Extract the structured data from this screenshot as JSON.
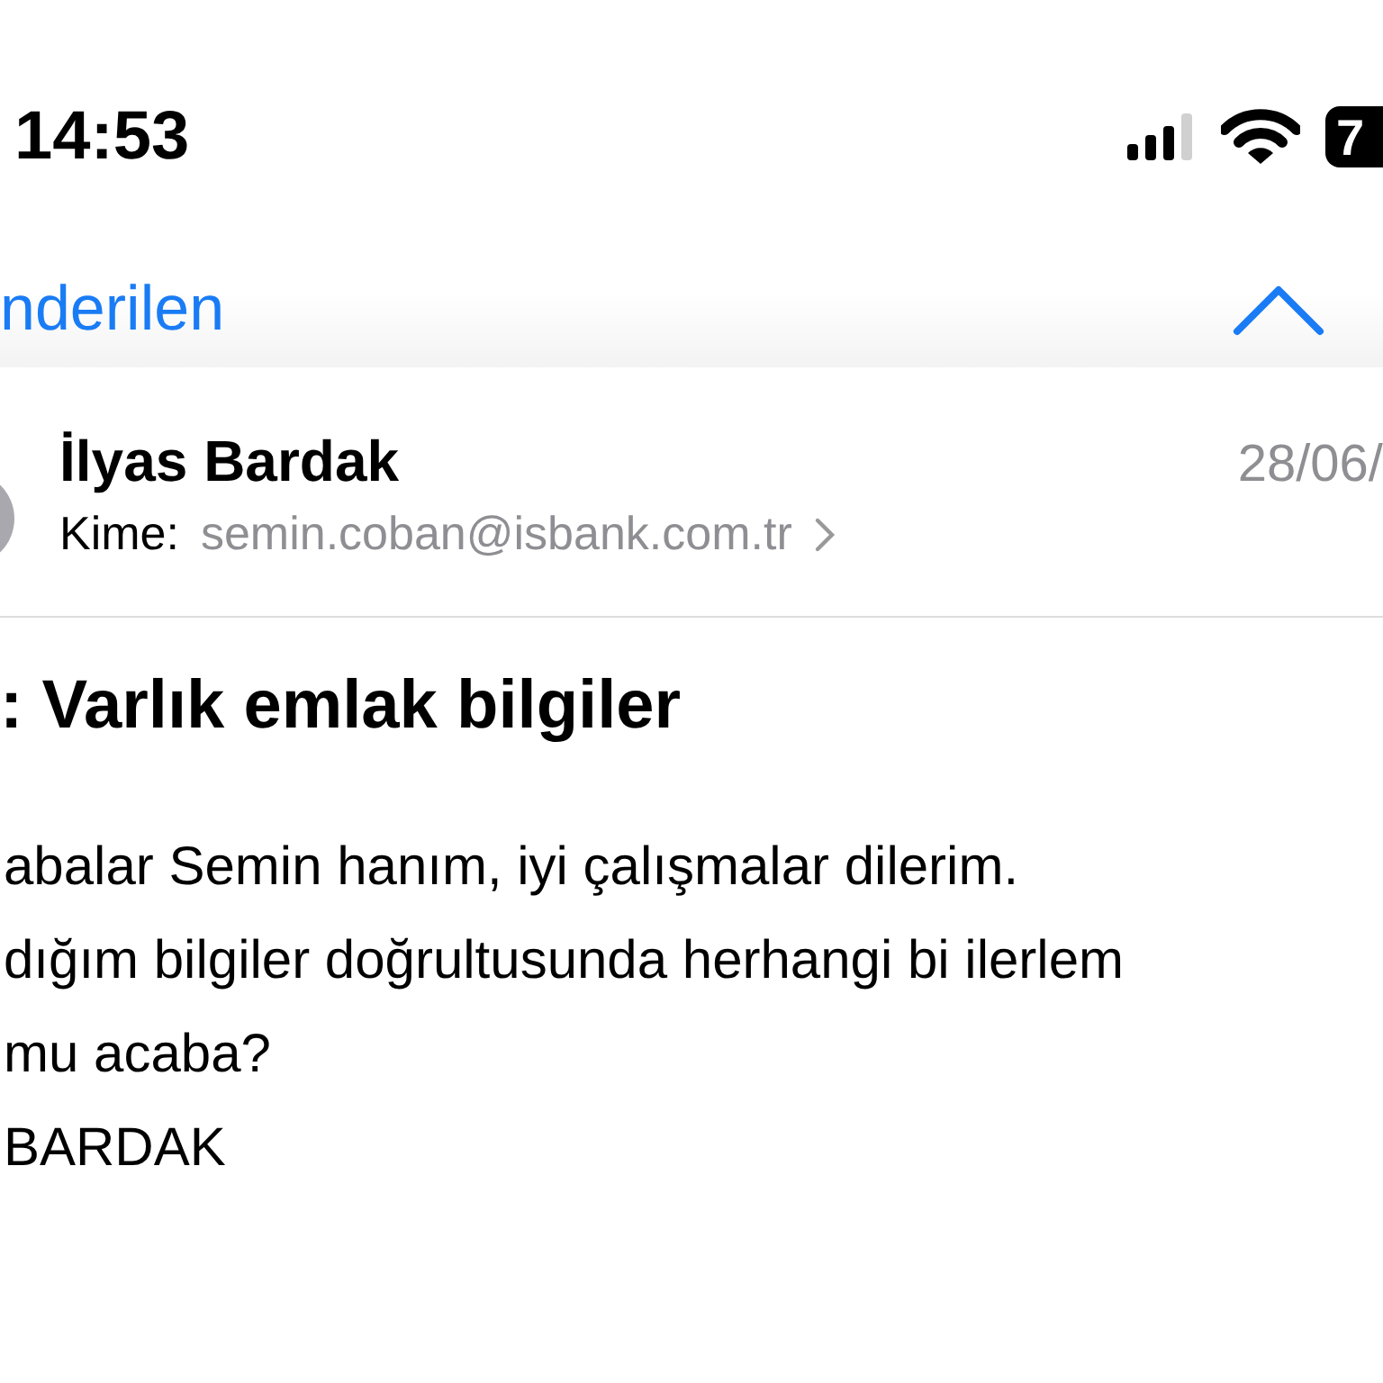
{
  "status_bar": {
    "time": "14:53",
    "battery": "7"
  },
  "nav": {
    "back_label": "nderilen"
  },
  "message": {
    "sender": "İlyas Bardak",
    "date": "28/06/",
    "to_label": "Kime:",
    "to_address": "semin.coban@isbank.com.tr",
    "subject": ": Varlık emlak bilgiler",
    "body_lines": [
      "abalar Semin hanım, iyi çalışmalar dilerim.",
      "dığım bilgiler doğrultusunda  herhangi bi ilerlem",
      "mu acaba?",
      "BARDAK"
    ]
  }
}
